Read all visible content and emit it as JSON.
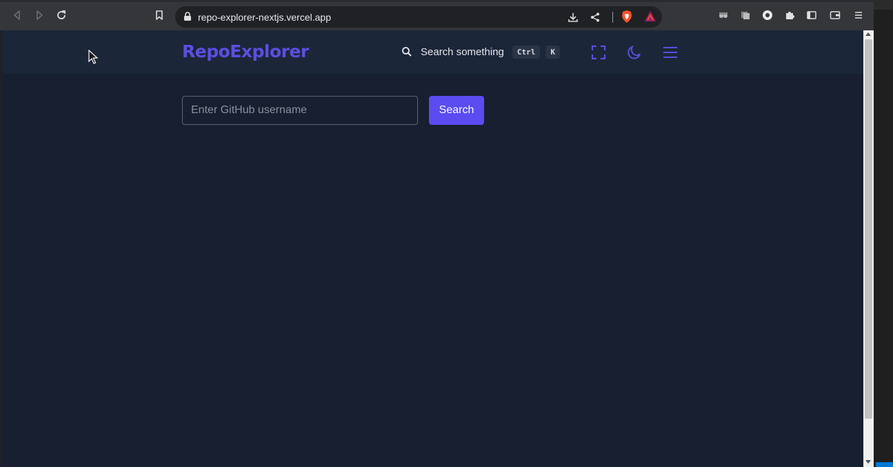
{
  "browser": {
    "url": "repo-explorer-nextjs.vercel.app",
    "icons": {
      "back": "arrow-left-icon",
      "forward": "arrow-right-icon",
      "reload": "reload-icon",
      "bookmark": "bookmark-icon",
      "lock": "lock-icon",
      "download": "download-icon",
      "share": "share-icon",
      "shields": "brave-shields-icon",
      "rewards": "brave-rewards-icon",
      "extensions": [
        "extension-a-icon",
        "extension-b-icon",
        "extension-c-icon",
        "puzzle-icon"
      ],
      "sidebar": "sidebar-icon",
      "wallet": "wallet-icon",
      "menu": "menu-icon"
    }
  },
  "app": {
    "logo": "RepoExplorer",
    "search": {
      "label": "Search something",
      "shortcut_ctrl": "Ctrl",
      "shortcut_key": "K"
    },
    "colors": {
      "accent": "#5b4fe0",
      "button": "#5a4cf0",
      "background": "#171f30",
      "header": "#1b2639"
    }
  },
  "main": {
    "username_placeholder": "Enter GitHub username",
    "username_value": "",
    "search_button": "Search"
  }
}
